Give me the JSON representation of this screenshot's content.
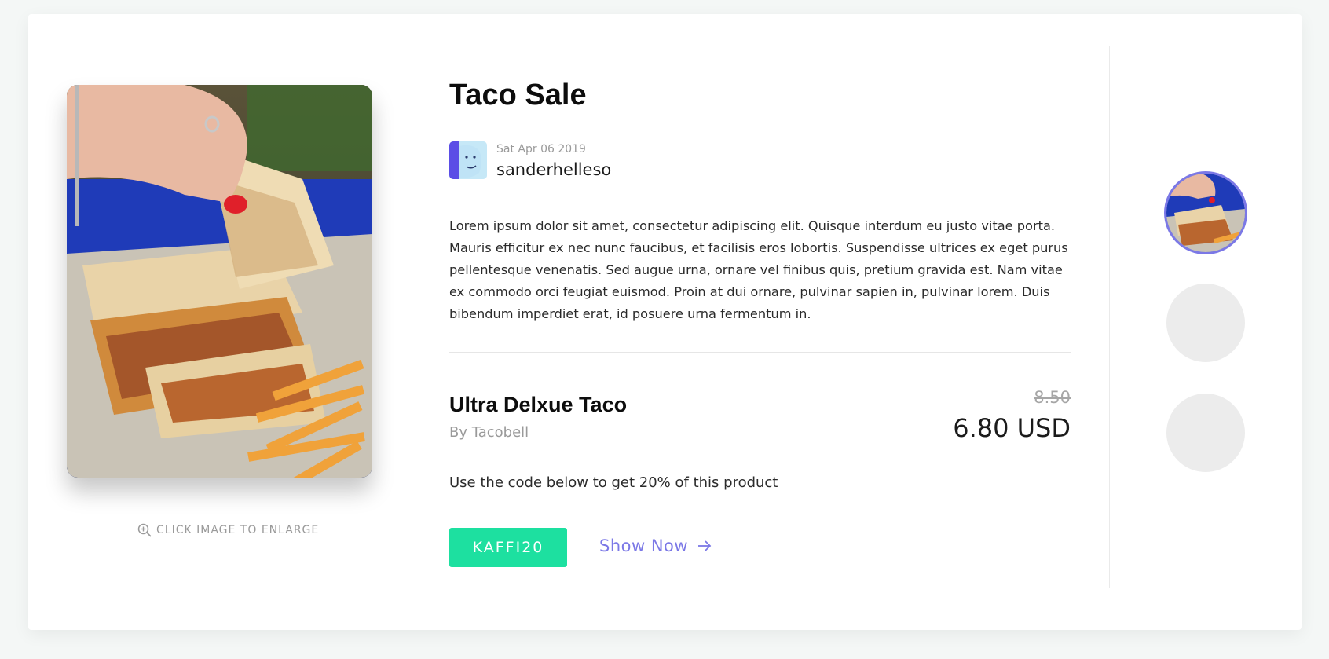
{
  "post": {
    "title": "Taco Sale",
    "date": "Sat Apr 06 2019",
    "author": "sanderhelleso",
    "description": "Lorem ipsum dolor sit amet, consectetur adipiscing elit. Quisque interdum eu justo vitae porta. Mauris efficitur ex nec nunc faucibus, et facilisis eros lobortis. Suspendisse ultrices ex eget purus pellentesque venenatis. Sed augue urna, ornare vel finibus quis, pretium gravida est. Nam vitae ex commodo orci feugiat euismod. Proin at dui ornare, pulvinar sapien in, pulvinar lorem. Duis bibendum imperdiet erat, id posuere urna fermentum in."
  },
  "image": {
    "enlarge_label": "CLICK IMAGE TO ENLARGE",
    "icon": "zoom-in-icon"
  },
  "product": {
    "name": "Ultra Delxue Taco",
    "by": "By Tacobell",
    "old_price": "8.50",
    "new_price": "6.80 USD"
  },
  "promo": {
    "text": "Use the code below to get 20% of this product",
    "code": "KAFFI20",
    "show_now_label": "Show Now",
    "show_now_icon": "arrow-right-icon"
  },
  "colors": {
    "accent_green": "#1de0a0",
    "accent_purple": "#7b78e6",
    "background": "#f4f7f6"
  },
  "thumbnails": [
    {
      "name": "thumbnail-1",
      "active": true
    },
    {
      "name": "thumbnail-2",
      "active": false
    },
    {
      "name": "thumbnail-3",
      "active": false
    }
  ]
}
